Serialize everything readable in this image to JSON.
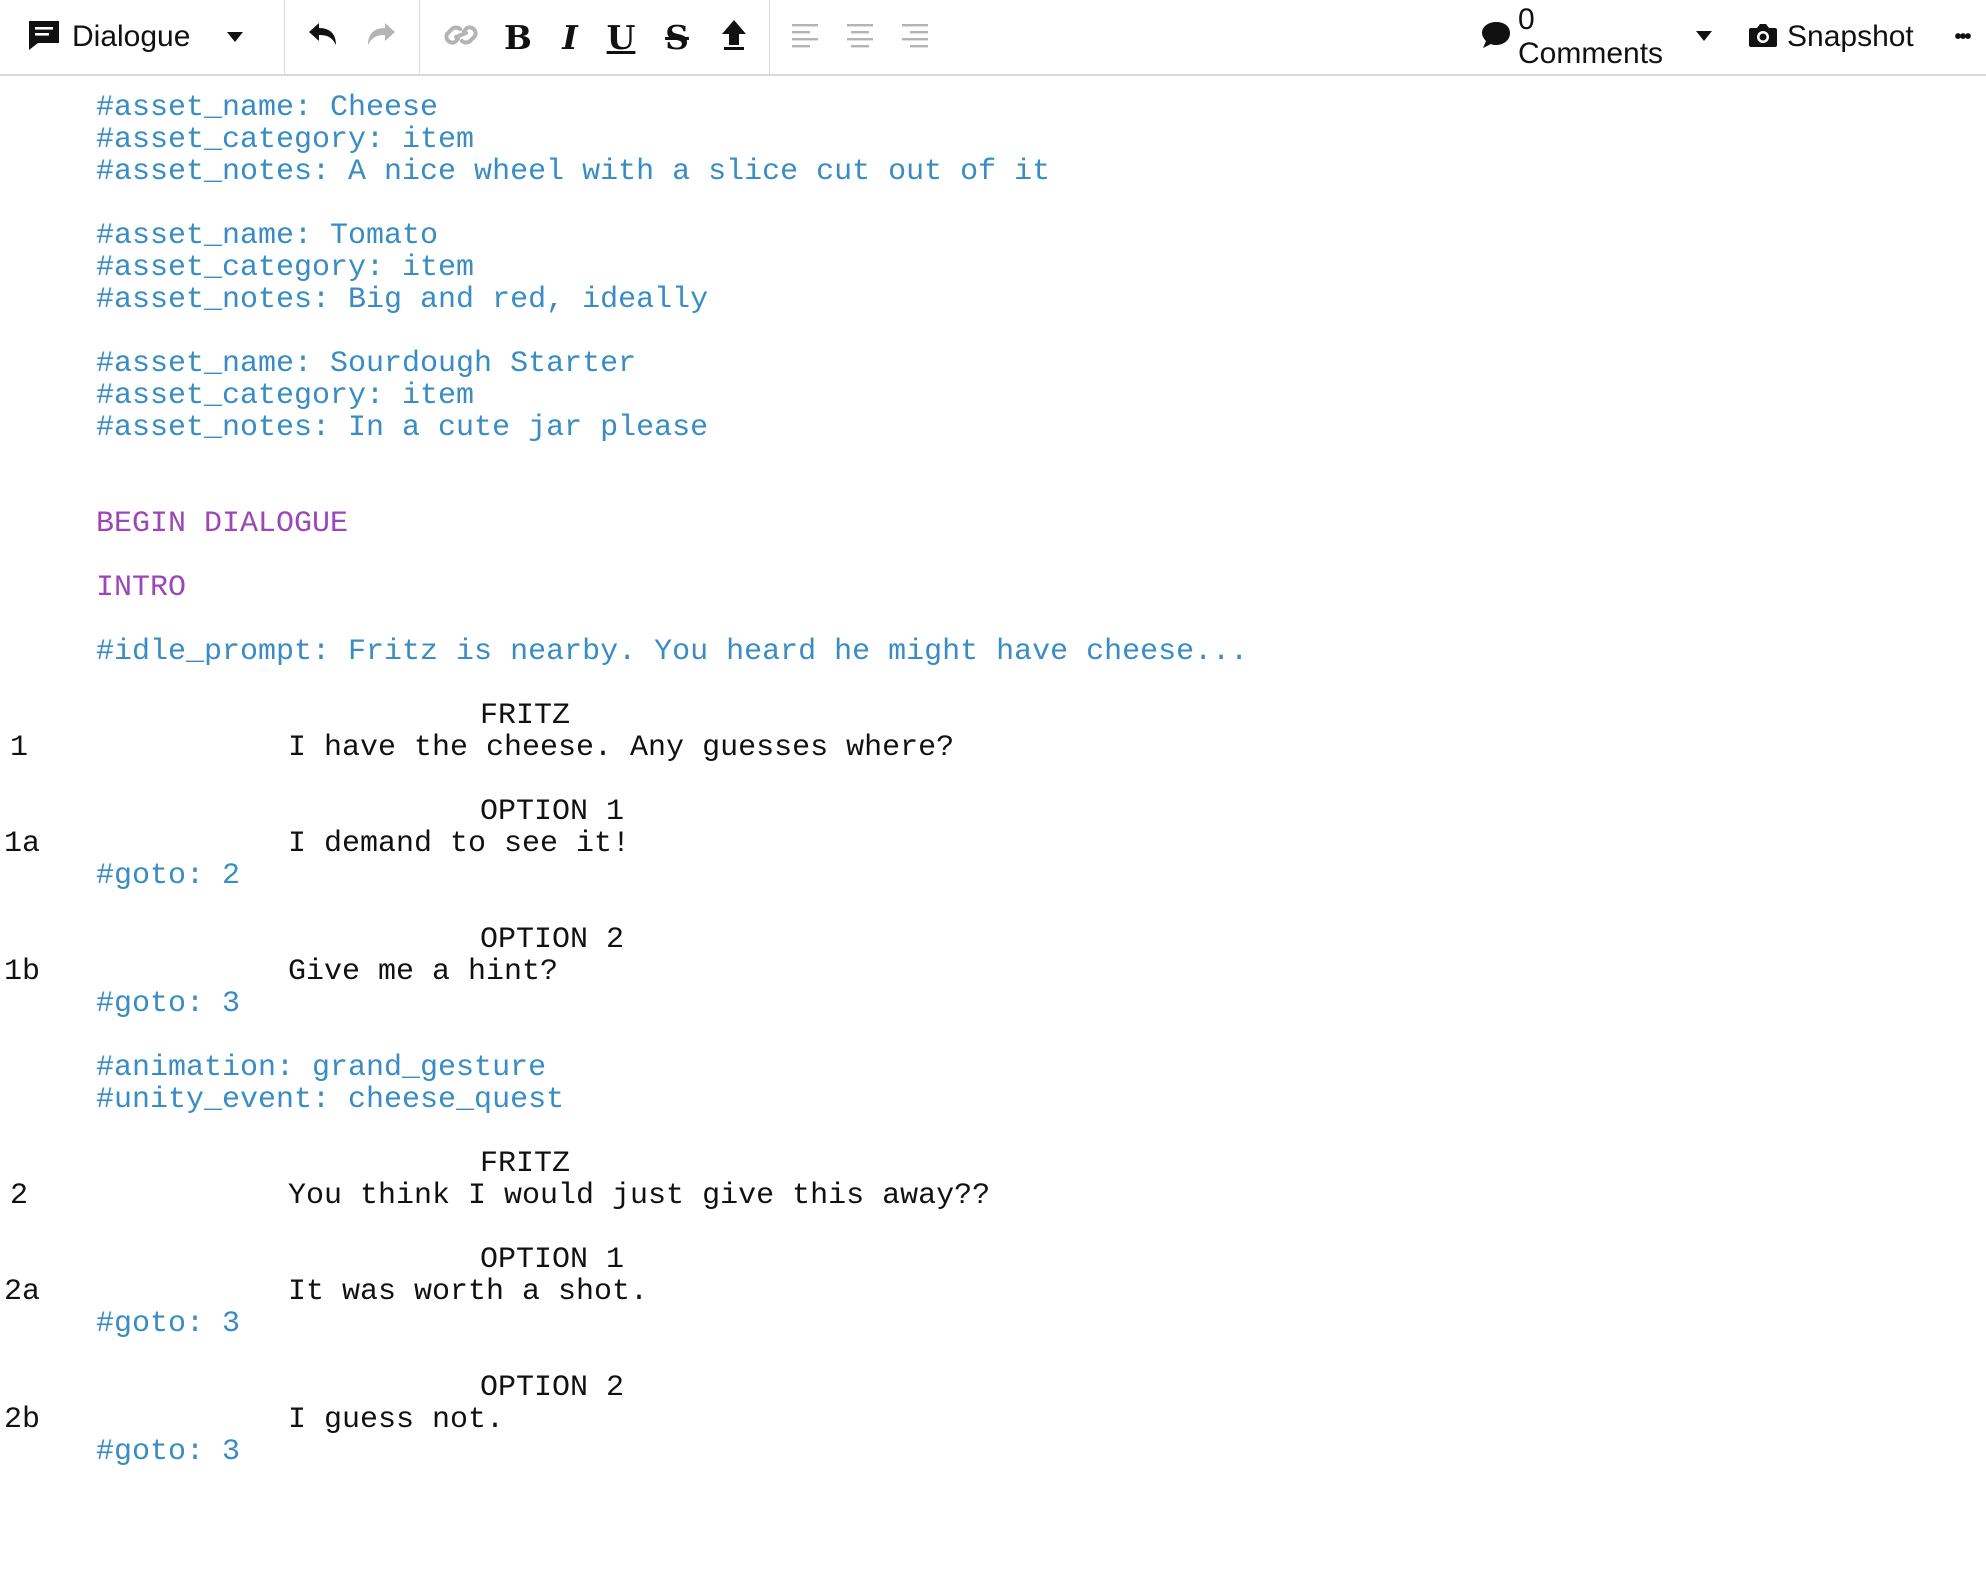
{
  "toolbar": {
    "element_type": "Dialogue",
    "comments_label": "0 Comments",
    "snapshot_label": "Snapshot",
    "bold_glyph": "B",
    "italic_glyph": "I",
    "underline_glyph": "U",
    "strike_glyph": "S",
    "more_glyph": "•••"
  },
  "document": {
    "assets": [
      {
        "name": "#asset_name: Cheese",
        "category": "#asset_category: item",
        "notes": "#asset_notes: A nice wheel with a slice cut out of it"
      },
      {
        "name": "#asset_name: Tomato",
        "category": "#asset_category: item",
        "notes": "#asset_notes: Big and red, ideally"
      },
      {
        "name": "#asset_name: Sourdough Starter",
        "category": "#asset_category: item",
        "notes": "#asset_notes: In a cute jar please"
      }
    ],
    "begin": "BEGIN DIALOGUE",
    "intro": "INTRO",
    "idle_prompt": "#idle_prompt: Fritz is nearby. You heard he might have cheese...",
    "block1": {
      "character": "FRITZ",
      "number": "1",
      "line": "I have the cheese. Any guesses where?",
      "options": [
        {
          "label": "OPTION 1",
          "number": "1a",
          "text": "I demand to see it!",
          "goto": "#goto: 2"
        },
        {
          "label": "OPTION 2",
          "number": "1b",
          "text": "Give me a hint?",
          "goto": "#goto: 3"
        }
      ]
    },
    "animation": "#animation: grand_gesture",
    "unity_event": "#unity_event: cheese_quest",
    "block2": {
      "character": "FRITZ",
      "number": "2",
      "line": "You think I would just give this away??",
      "options": [
        {
          "label": "OPTION 1",
          "number": "2a",
          "text": "It was worth a shot.",
          "goto": "#goto: 3"
        },
        {
          "label": "OPTION 2",
          "number": "2b",
          "text": "I guess not.",
          "goto": "#goto: 3"
        }
      ]
    }
  }
}
